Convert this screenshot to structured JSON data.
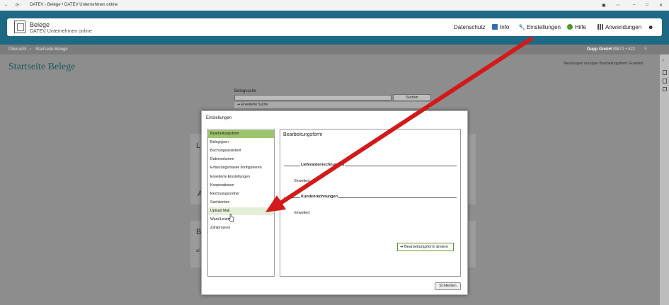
{
  "window": {
    "title": "DATEV - Belege • DATEV Unternehmen online"
  },
  "app": {
    "name": "Belege",
    "subtitle": "DATEV Unternehmen online"
  },
  "nav": {
    "datenschutz": "Datenschutz",
    "info": "Info",
    "einstellungen": "Einstellungen",
    "hilfe": "Hilfe",
    "anwendungen": "Anwendungen"
  },
  "breadcrumb": {
    "root": "Übersicht",
    "current": "Startseite Belege",
    "company": "Dupp GmbH",
    "client_number": "39871 • 422"
  },
  "page": {
    "title": "Startseite Belege",
    "right_link": "Neuerungen anzeigen  Bearbeitungsform: Erweitert"
  },
  "search": {
    "label": "Belegsuche",
    "button": "Suchen",
    "advanced": "Erweiterte Suche"
  },
  "background": {
    "letter_l": "L",
    "letter_a": "A",
    "letter_b": "B",
    "small_al": "al"
  },
  "dialog": {
    "title": "Einstellungen",
    "menu": [
      "Bearbeitungsform",
      "Belegtypen",
      "Buchungsassistent",
      "Datenvolumen",
      "Erfassungsmaske konfigurieren",
      "Erweiterte Einstellungen",
      "Kooperationen",
      "Rechnungsordner",
      "Sachkonten",
      "Upload Mail",
      "Ware/Leistung",
      "Zahlprozess"
    ],
    "selected_index": 0,
    "hover_index": 9,
    "detail": {
      "title": "Bearbeitungsform",
      "section1_label": "Lieferantenrechnungen",
      "section1_value": "Erweitert",
      "section2_label": "Kundenrechnungen",
      "section2_value": "Erweitert",
      "change_button": "Bearbeitungsform ändern"
    },
    "close_button": "Schließen"
  },
  "colors": {
    "brand_band": "#1e6a84",
    "selected_item": "#9cc46a",
    "hover_item": "#e4efd7",
    "annotation_arrow": "#d21a1a"
  }
}
